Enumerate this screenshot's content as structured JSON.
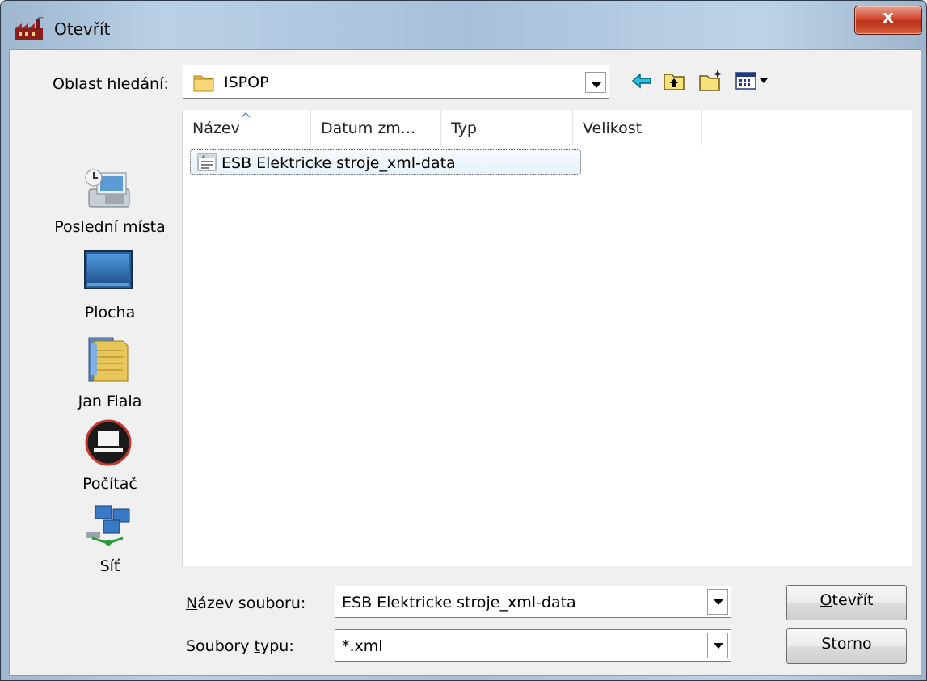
{
  "window": {
    "title": "Otevřít",
    "close_label": "x"
  },
  "lookin": {
    "label_pre": "Oblast ",
    "label_key": "h",
    "label_post": "ledání:",
    "value": "ISPOP"
  },
  "toolbar": {
    "icons": [
      "back-arrow-icon",
      "up-folder-icon",
      "new-folder-icon",
      "view-menu-icon"
    ]
  },
  "places": [
    {
      "label": "Poslední místa",
      "icon": "recent-places-icon"
    },
    {
      "label": "Plocha",
      "icon": "desktop-icon"
    },
    {
      "label": "Jan Fiala",
      "icon": "user-folder-icon"
    },
    {
      "label": "Počítač",
      "icon": "computer-icon"
    },
    {
      "label": "Síť",
      "icon": "network-icon"
    }
  ],
  "columns": [
    {
      "label": "Název",
      "sorted": true
    },
    {
      "label": "Datum zm..."
    },
    {
      "label": "Typ"
    },
    {
      "label": "Velikost"
    }
  ],
  "files": [
    {
      "name": "ESB Elektricke stroje_xml-data",
      "icon": "xml-file-icon",
      "selected": true
    }
  ],
  "filename": {
    "label_key": "N",
    "label_post": "ázev souboru:",
    "value": "ESB Elektricke stroje_xml-data"
  },
  "filetype": {
    "label_pre": "Soubory ",
    "label_key": "t",
    "label_post": "ypu:",
    "value": "*.xml"
  },
  "buttons": {
    "open_key": "O",
    "open_post": "tevřít",
    "cancel": "Storno"
  },
  "colors": {
    "frame": "#b0c8e0",
    "client": "#f0f0f0",
    "close": "#c94a2c",
    "selection": "#e6f2fc"
  }
}
